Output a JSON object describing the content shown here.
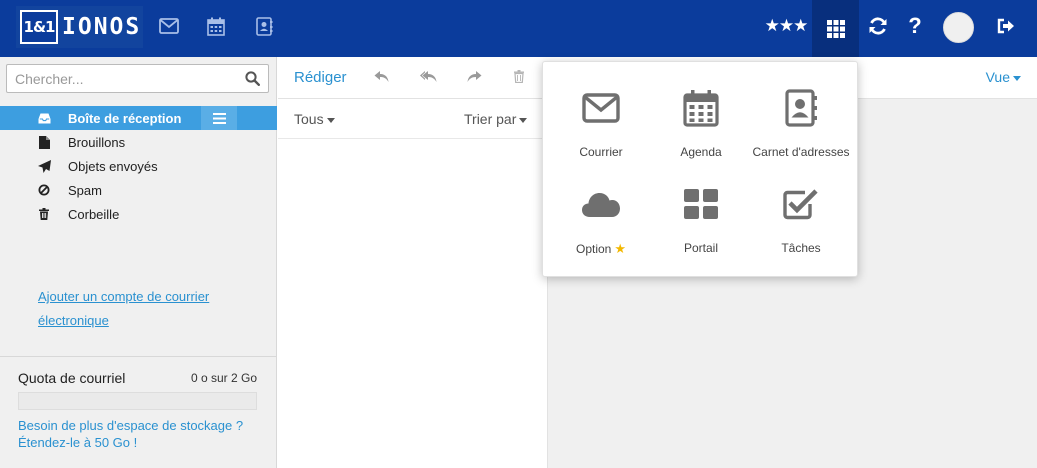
{
  "header": {
    "logo_box": "1&1",
    "logo_text": "IONOS",
    "icons": [
      "envelope-icon",
      "calendar-icon",
      "contacts-icon",
      "star-rating-icon",
      "apps-grid-icon",
      "refresh-icon",
      "help-icon",
      "user-avatar",
      "logout-icon"
    ],
    "rating": "★★★"
  },
  "search": {
    "placeholder": "Chercher..."
  },
  "folders": [
    {
      "label": "Boîte de réception",
      "icon": "inbox-icon",
      "active": true
    },
    {
      "label": "Brouillons",
      "icon": "draft-icon",
      "active": false
    },
    {
      "label": "Objets envoyés",
      "icon": "sent-icon",
      "active": false
    },
    {
      "label": "Spam",
      "icon": "spam-icon",
      "active": false
    },
    {
      "label": "Corbeille",
      "icon": "trash-icon",
      "active": false
    }
  ],
  "add_account_link": "Ajouter un compte de courrier électronique",
  "quota": {
    "title": "Quota de courriel",
    "value": "0 o sur 2 Go",
    "fill_fraction": 0,
    "upsell_line1": "Besoin de plus d'espace de stockage ?",
    "upsell_line2": "Étendez-le à 50 Go !"
  },
  "toolbar": {
    "compose": "Rédiger",
    "icons": [
      "reply-icon",
      "reply-all-icon",
      "forward-icon",
      "delete-icon"
    ],
    "view": "Vue"
  },
  "list": {
    "filter": "Tous",
    "sort": "Trier par"
  },
  "apps": [
    {
      "label": "Courrier",
      "icon": "mail-app-icon"
    },
    {
      "label": "Agenda",
      "icon": "calendar-app-icon"
    },
    {
      "label": "Carnet d'adresses",
      "icon": "address-book-app-icon"
    },
    {
      "label": "Option",
      "icon": "cloud-app-icon",
      "star": "★"
    },
    {
      "label": "Portail",
      "icon": "portal-app-icon"
    },
    {
      "label": "Tâches",
      "icon": "tasks-app-icon"
    }
  ],
  "colors": {
    "header_bg": "#0b3c9c",
    "accent": "#2a91d0",
    "active_folder": "#3d9ee0",
    "app_icon": "#6f6f6f"
  }
}
